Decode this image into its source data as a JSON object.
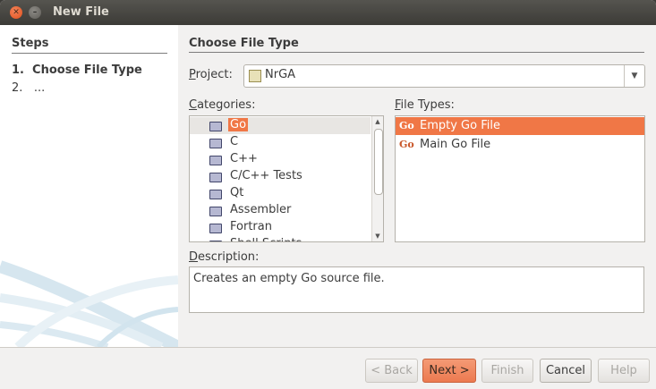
{
  "window": {
    "title": "New File"
  },
  "steps": {
    "title": "Steps",
    "items": [
      {
        "num": "1.",
        "label": "Choose File Type"
      },
      {
        "num": "2.",
        "label": "..."
      }
    ]
  },
  "main": {
    "title": "Choose File Type",
    "project_label": "Project:",
    "project_value": "NrGA",
    "categories_label": "Categories:",
    "categories": [
      "Go",
      "C",
      "C++",
      "C/C++ Tests",
      "Qt",
      "Assembler",
      "Fortran",
      "Shell Scripts"
    ],
    "selected_category": "Go",
    "file_types_label": "File Types:",
    "file_types": [
      {
        "icon": "Go",
        "label": "Empty Go File",
        "selected": true
      },
      {
        "icon": "Go",
        "label": "Main Go File",
        "selected": false
      }
    ],
    "description_label": "Description:",
    "description": "Creates an empty Go source file."
  },
  "buttons": {
    "back": "< Back",
    "next": "Next >",
    "finish": "Finish",
    "cancel": "Cancel",
    "help": "Help"
  },
  "colors": {
    "accent": "#f07746",
    "titlebar": "#3c3b37"
  }
}
